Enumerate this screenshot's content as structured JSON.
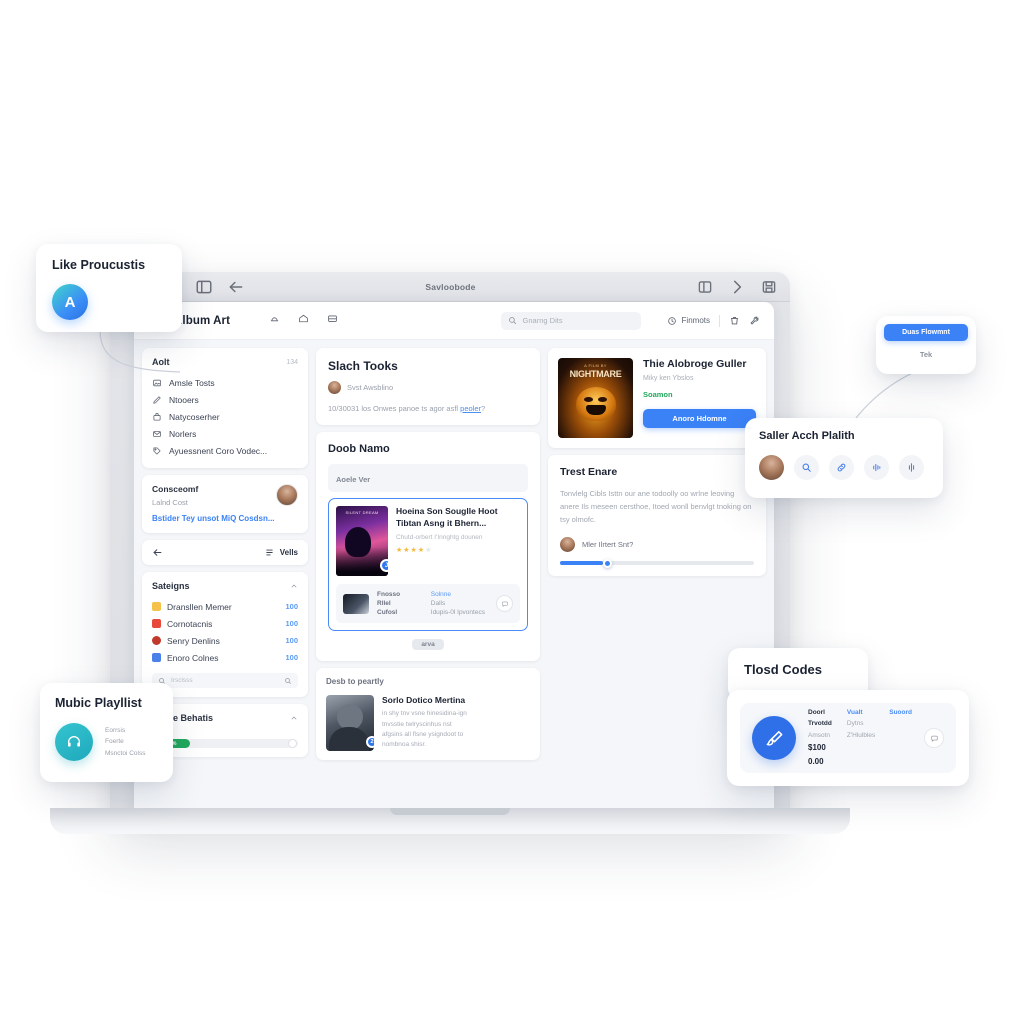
{
  "window": {
    "title": "Savloobode",
    "traffic_lights": [
      "close",
      "minimize",
      "maximize"
    ],
    "left_icons": [
      "sidebar-toggle-icon",
      "back-arrow-icon"
    ],
    "right_icons": [
      "layout-icon",
      "forward-chevron-icon",
      "save-icon"
    ]
  },
  "app": {
    "brand": {
      "name": "Album Art",
      "logo": "album-logo-icon"
    },
    "header_icons": [
      "notification-icon",
      "home-icon",
      "inbox-icon"
    ],
    "search": {
      "placeholder": "Gnarng Dits",
      "icon": "search-icon"
    },
    "status_chip": {
      "label": "Finmots",
      "icon": "clock-icon"
    },
    "tools": [
      "trash-icon",
      "wrench-icon"
    ]
  },
  "sidebar": {
    "section_one": {
      "title": "Aolt",
      "meta": "134",
      "items": [
        {
          "label": "Amsle Tosts",
          "icon": "image-icon"
        },
        {
          "label": "Ntooers",
          "icon": "pencil-icon"
        },
        {
          "label": "Natycoserher",
          "icon": "bag-icon"
        },
        {
          "label": "Norlers",
          "icon": "mail-icon"
        },
        {
          "label": "Ayuessnent Coro Vodec...",
          "icon": "tag-icon"
        }
      ]
    },
    "profile": {
      "title": "Consceomf",
      "subtitle": "Lalnd Cost",
      "link": "Bstider Tey unsot MiQ Cosdsn...",
      "avatar": "user-avatar"
    },
    "navrow": {
      "back_icon": "back-arrow-icon",
      "label": "Vells",
      "list_icon": "list-icon"
    },
    "settings": {
      "title": "Sateigns",
      "chevron": "chevron-up-icon",
      "rows": [
        {
          "label": "Dransllen Memer",
          "count": "100",
          "color": "#f4c24a"
        },
        {
          "label": "Cornotacnis",
          "count": "100",
          "color": "#e8493b"
        },
        {
          "label": "Senry Denlins",
          "count": "100",
          "color": "#c0392b"
        },
        {
          "label": "Enoro Colnes",
          "count": "100",
          "color": "#4a80e8"
        }
      ],
      "search_placeholder": "Irsclsss"
    },
    "more": {
      "title": "Mlone Behatis",
      "chevron": "chevron-up-icon",
      "progress_label": "Speed",
      "progress_value": "62%",
      "progress_percent": 26
    }
  },
  "middle": {
    "post": {
      "title": "Slach Tooks",
      "author": "Svst Awsblino",
      "body_before": "10/30031 los Onwes panoe ts agor asfl ",
      "body_link": "peoler",
      "body_after": "?"
    },
    "section": {
      "title": "Doob Namo",
      "subbar": "Aoele Ver",
      "selected_track": {
        "art_caption": "SILENT DREAM",
        "badge": "J",
        "title": "Hoeina Son Souglle Hoot Tibtan Asng it Bhern...",
        "subtitle": "Chutd-orbert I'Innghtg dounen",
        "rating": 4,
        "rating_max": 5,
        "detail_rows": [
          {
            "key": "Fnosso",
            "value": "Solnne",
            "value_style": "blue"
          },
          {
            "key": "Rllel",
            "value": "Dalls",
            "value_style": "muted"
          },
          {
            "key": "Cufosl",
            "value": "Idupis-0l Ipvontecs",
            "value_style": "muted"
          }
        ],
        "detail_button_icon": "comment-icon"
      },
      "pill": "arva"
    },
    "list": {
      "header": "Desb to peartly",
      "entry": {
        "title": "Sorlo Dotico Mertina",
        "badge": "2",
        "lines": [
          "in shy tnv vsne hinesidina-ign",
          "tnvsstie twlryscinhus nst",
          "afgsins all flsne ysigndoot to",
          "nombnoa shisr."
        ]
      }
    }
  },
  "right": {
    "featured": {
      "art_top": "A FILM BY",
      "art_title": "NIGHTMARE",
      "title": "Thie Alobroge Guller",
      "subtitle": "Miky ken Ybslos",
      "status": "Soamon",
      "button": "Anoro Hdomne"
    },
    "note": {
      "title": "Trest Enare",
      "body": "Tonvlelg Cibls Isttn our ane todoolly oo wrlne leoving anere Ils meseen cersthoe, Itoed wonll benvlgt tnoking on tsy olmofc.",
      "user": "Mler Ilrtert Snt?",
      "slider_percent": 22
    }
  },
  "floating": {
    "like": {
      "title": "Like Proucustis",
      "avatar_letter": "A"
    },
    "music": {
      "title": "Mubic Playllist",
      "icon": "headphones-icon",
      "lines": [
        "Eorrsis",
        "Foerte",
        "Msnctoi Colss"
      ]
    },
    "promo": {
      "button": "Duas Flowmnt",
      "subtitle": "Tek"
    },
    "share": {
      "title": "Saller Acch Plalith",
      "icons": [
        "user-avatar",
        "search-icon",
        "link-icon",
        "waveform-icon",
        "equalizer-icon"
      ]
    },
    "tlosd": {
      "title": "Tlosd Codes"
    },
    "payment": {
      "icon": "brush-icon",
      "col1": {
        "title": "Doorl Trvotdd",
        "sub": "Amsotn",
        "price": "$100 0.00"
      },
      "col2": {
        "title": "Vualt",
        "sub": "Dytns",
        "extra": "Z'Hlulbles"
      },
      "col3": {
        "title": "Suoord"
      },
      "button_icon": "comment-icon"
    }
  },
  "colors": {
    "accent_blue": "#3b82f6",
    "status_green": "#22a85c",
    "teal": "#1fa9bd",
    "star_gold": "#f2b93c"
  }
}
